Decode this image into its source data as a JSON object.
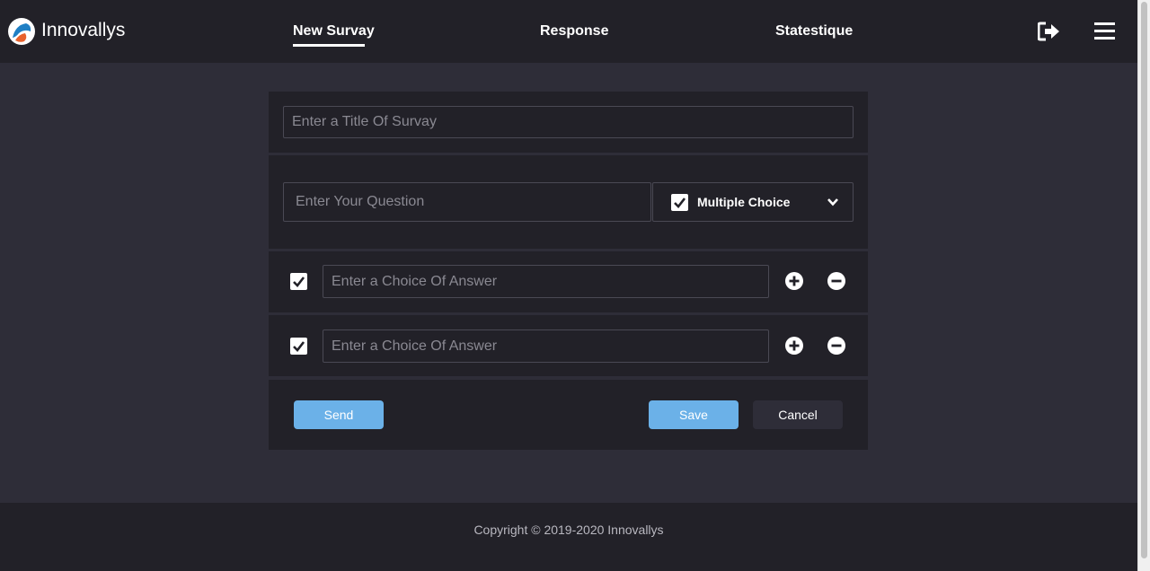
{
  "brand": {
    "name": "Innovallys"
  },
  "nav": {
    "items": [
      "New Survay",
      "Response",
      "Statestique"
    ],
    "active": "New Survay"
  },
  "survey": {
    "title_placeholder": "Enter a Title Of  Survay",
    "question_placeholder": "Enter Your Question",
    "question_type": "Multiple Choice",
    "choices": [
      {
        "placeholder": "Enter a Choice Of Answer",
        "checked": true
      },
      {
        "placeholder": "Enter a Choice Of Answer",
        "checked": true
      }
    ]
  },
  "actions": {
    "send": "Send",
    "save": "Save",
    "cancel": "Cancel"
  },
  "footer": {
    "copyright": "Copyright © 2019-2020 Innovallys"
  },
  "colors": {
    "header_bg": "#222128",
    "page_bg": "#2e2d38",
    "accent": "#6bb1e8"
  }
}
